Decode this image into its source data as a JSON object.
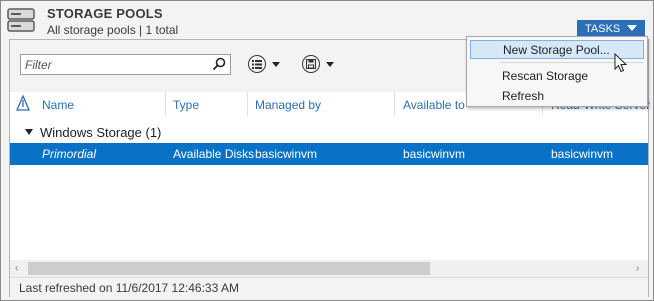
{
  "header": {
    "title": "STORAGE POOLS",
    "subtitle": "All storage pools | 1 total",
    "tasks_label": "TASKS"
  },
  "toolbar": {
    "filter_placeholder": "Filter",
    "filter_value": ""
  },
  "columns": [
    "Name",
    "Type",
    "Managed by",
    "Available to",
    "Read-Write Server"
  ],
  "group": {
    "label": "Windows Storage (1)"
  },
  "rows": [
    {
      "name": "Primordial",
      "type": "Available Disks",
      "managed_by": "basicwinvm",
      "available_to": "basicwinvm",
      "read_write_server": "basicwinvm"
    }
  ],
  "footer": {
    "status": "Last refreshed on 11/6/2017 12:46:33 AM"
  },
  "tasks_menu": {
    "items": [
      "New Storage Pool...",
      "Rescan Storage",
      "Refresh"
    ],
    "highlighted": "New Storage Pool..."
  },
  "colors": {
    "accent": "#2d6fb6",
    "selected_row": "#0a72c6",
    "menu_highlight": "#d6e8f8"
  },
  "icons": [
    "storage-pools-icon",
    "search-icon",
    "list-view-icon",
    "save-icon",
    "sort-icon",
    "mouse-pointer-icon"
  ]
}
